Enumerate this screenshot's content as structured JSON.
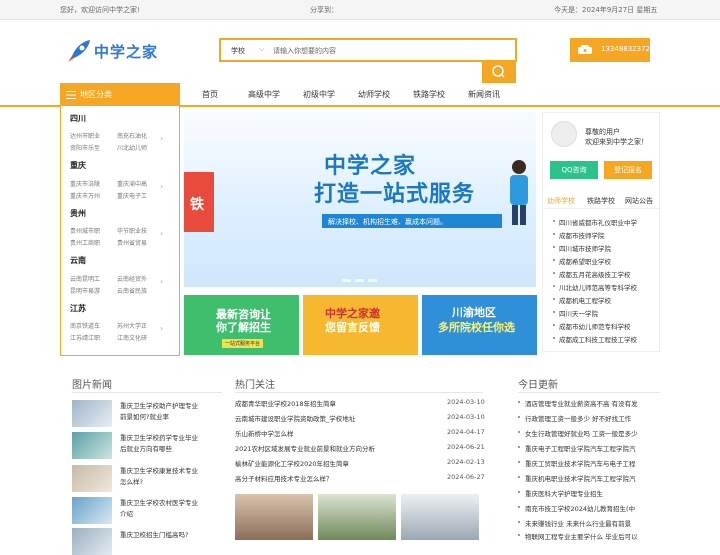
{
  "topbar": {
    "greeting": "您好，欢迎访问中学之家!",
    "share": "分享到：",
    "today": "今天是：2024年9月27日 星期五"
  },
  "logo": {
    "text": "中学之家"
  },
  "search": {
    "select": "学校",
    "placeholder": "请输入你想要的内容"
  },
  "phone": "13348832372",
  "region": {
    "title": "地区分类",
    "groups": [
      {
        "name": "四川",
        "items": [
          "达州市职业",
          "南充石油化",
          "资阳市乐至",
          "川北幼儿师"
        ]
      },
      {
        "name": "重庆",
        "items": [
          "重庆市涪陵",
          "重庆渝中高",
          "重庆市万州",
          "重庆电子工"
        ]
      },
      {
        "name": "贵州",
        "items": [
          "贵州城市职",
          "毕节职业技",
          "贵州工商职",
          "贵州省贸易"
        ]
      },
      {
        "name": "云南",
        "items": [
          "云南昆明工",
          "云南经贸外",
          "昆明市易游",
          "云南省民族"
        ]
      },
      {
        "name": "江苏",
        "items": [
          "南京铁道车",
          "苏州大学正",
          "江苏靖江职",
          "江南文化研"
        ]
      }
    ]
  },
  "nav": [
    "首页",
    "高级中学",
    "初级中学",
    "幼师学校",
    "铁路学校",
    "新闻资讯"
  ],
  "banner": {
    "title1": "中学之家",
    "title2": "打造一站式服务",
    "subtitle": "解决择校、机构招生难、赢成本问题。",
    "side": "铁"
  },
  "promos": [
    {
      "line1": "最新咨询让",
      "line2": "你了解招生",
      "tag": "一站式服务平台",
      "color": "#3fbf6e"
    },
    {
      "line1": "中学之家邀",
      "line2": "您留言反馈",
      "tag": "",
      "color": "#f5b82e"
    },
    {
      "line1": "川渝地区",
      "line2": "多所院校任你选",
      "tag": "",
      "color": "#2f8fd8"
    }
  ],
  "user": {
    "greeting": "尊敬的用户",
    "welcome": "欢迎来到中学之家！",
    "qq_button": "QQ咨询",
    "signup_button": "登记报名",
    "tabs": [
      "幼师学校",
      "铁路学校",
      "网站公告"
    ],
    "schools": [
      "四川省威都市礼仪职业中学",
      "成都市技师学院",
      "四川城市技师学院",
      "成都希望职业学校",
      "成都五月花高级技工学校",
      "川北幼儿师范高等专科学校",
      "成都机电工程学校",
      "四川天一学院",
      "成都市幼儿师范专科学校",
      "成都成工科技工程技工学校"
    ]
  },
  "pic_news": {
    "title": "图片新闻",
    "items": [
      "重庆卫生学校助产护理专业前景如何?就业率",
      "重庆卫生学校药学专业毕业后就业方向有哪些",
      "重庆卫生学校康复技术专业怎么样?",
      "重庆卫生学校农村医学专业介绍",
      "重庆卫校招生门槛高吗?"
    ]
  },
  "hot": {
    "title": "热门关注",
    "items": [
      {
        "text": "成都青华职业学校2018年招生简章",
        "date": "2024-03-10"
      },
      {
        "text": "云南城市建设职业学院资助政策_学校地址",
        "date": "2024-03-10"
      },
      {
        "text": "乐山新桥中学怎么样",
        "date": "2024-04-17"
      },
      {
        "text": "2021农村区域发展专业就业前景和就业方向分析",
        "date": "2024-06-21"
      },
      {
        "text": "榆林矿业能源化工学校2020年招生简章",
        "date": "2024-02-13"
      },
      {
        "text": "高分子材料应用技术专业怎么样？",
        "date": "2024-06-27"
      }
    ]
  },
  "today_news": {
    "title": "今日更新",
    "items": [
      "酒店管理专业就业薪资高不高 有没有发",
      "行政管理工资一般多少 好不好找工作",
      "女生行政管理好就业吗 工资一般是多少",
      "重庆电子工程职业学院汽车工程学院汽",
      "重庆工贸职业技术学院汽车与电子工程",
      "重庆机电职业技术学院汽车工程学院汽",
      "重庆医科大学护理专业招生",
      "南充市技工学校2024幼儿教育招生(中",
      "未来赚钱行业 未来什么行业最有前景",
      "物联网工程专业主要学什么 毕业后可以"
    ]
  }
}
